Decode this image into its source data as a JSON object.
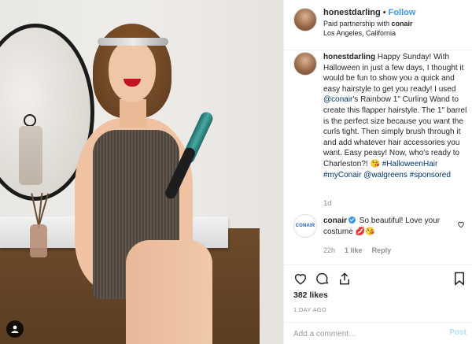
{
  "header": {
    "username": "honestdarling",
    "separator": "•",
    "follow_label": "Follow",
    "partnership_prefix": "Paid partnership with ",
    "partner": "conair",
    "location": "Los Angeles, California"
  },
  "caption": {
    "username": "honestdarling",
    "text_1": " Happy Sunday! With Halloween in just a few days, I thought it would be fun to show you a quick and easy hairstyle to get you ready! I used ",
    "mention_conair": "@conair",
    "text_2": "'s Rainbow 1\" Curling Wand to create this flapper hairstyle. The 1\" barrel is the perfect size because you want the curls tight. Then simply brush through it and add whatever hair accessories you want. Easy peasy! Now, who's ready to Charleston?! 😘 ",
    "tag_halloweenhair": "#HalloweenHair",
    "tag_myconair": "#myConair",
    "mention_walgreens": "@walgreens",
    "tag_sponsored": "#sponsored",
    "time": "1d"
  },
  "comment": {
    "logo_text": "CONAIR",
    "username": "conair",
    "text": "So beautiful! Love your costume 💋😘",
    "time": "22h",
    "likes": "1 like",
    "reply_label": "Reply"
  },
  "likes": "382 likes",
  "posted": "1 DAY AGO",
  "add_comment": {
    "placeholder": "Add a comment…",
    "post_label": "Post"
  }
}
